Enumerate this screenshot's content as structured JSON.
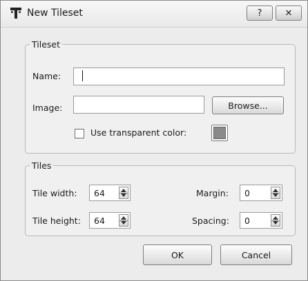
{
  "window": {
    "title": "New Tileset",
    "help_label": "?",
    "close_label": "✕"
  },
  "tileset": {
    "legend": "Tileset",
    "name_label": "Name:",
    "name_value": "",
    "image_label": "Image:",
    "image_value": "",
    "browse_label": "Browse...",
    "transparent_label": "Use transparent color:",
    "transparent_checked": false,
    "transparent_color": "#8a8a8a"
  },
  "tiles": {
    "legend": "Tiles",
    "tile_width_label": "Tile width:",
    "tile_width_value": "64",
    "tile_height_label": "Tile height:",
    "tile_height_value": "64",
    "margin_label": "Margin:",
    "margin_value": "0",
    "spacing_label": "Spacing:",
    "spacing_value": "0"
  },
  "buttons": {
    "ok_label": "OK",
    "cancel_label": "Cancel"
  },
  "icons": {
    "app": "tileset-icon",
    "help": "help-icon",
    "close": "close-icon",
    "spin": "spin-arrows-icon"
  }
}
